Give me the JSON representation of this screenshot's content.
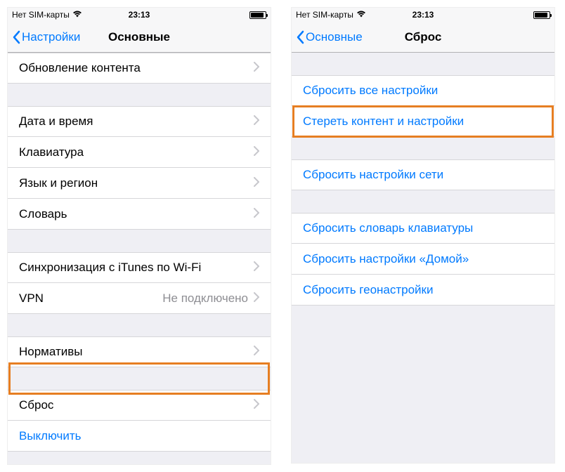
{
  "statusbar": {
    "carrier": "Нет SIM-карты",
    "time": "23:13"
  },
  "left": {
    "back": "Настройки",
    "title": "Основные",
    "rows": {
      "content_update": "Обновление контента",
      "date_time": "Дата и время",
      "keyboard": "Клавиатура",
      "language_region": "Язык и регион",
      "dictionary": "Словарь",
      "itunes_wifi": "Синхронизация с iTunes по Wi-Fi",
      "vpn": "VPN",
      "vpn_value": "Не подключено",
      "regulatory": "Нормативы",
      "reset": "Сброс",
      "shutdown": "Выключить"
    }
  },
  "right": {
    "back": "Основные",
    "title": "Сброс",
    "rows": {
      "reset_all": "Сбросить все настройки",
      "erase_all": "Стереть контент и настройки",
      "reset_network": "Сбросить настройки сети",
      "reset_keyboard": "Сбросить словарь клавиатуры",
      "reset_home": "Сбросить настройки «Домой»",
      "reset_location": "Сбросить геонастройки"
    }
  }
}
